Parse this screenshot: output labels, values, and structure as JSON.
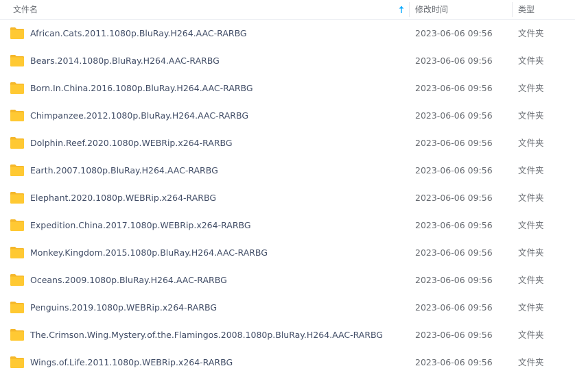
{
  "header": {
    "name_label": "文件名",
    "mtime_label": "修改时间",
    "type_label": "类型",
    "sort_icon": "arrow-up-icon",
    "sort_color": "#09aaff"
  },
  "colors": {
    "folder": "#ffc933",
    "folder_tab": "#f5b72a",
    "name_text": "#424e67",
    "meta_text": "#666a70"
  },
  "files": [
    {
      "name": "African.Cats.2011.1080p.BluRay.H264.AAC-RARBG",
      "mtime": "2023-06-06 09:56",
      "type": "文件夹",
      "icon": "folder-icon"
    },
    {
      "name": "Bears.2014.1080p.BluRay.H264.AAC-RARBG",
      "mtime": "2023-06-06 09:56",
      "type": "文件夹",
      "icon": "folder-icon"
    },
    {
      "name": "Born.In.China.2016.1080p.BluRay.H264.AAC-RARBG",
      "mtime": "2023-06-06 09:56",
      "type": "文件夹",
      "icon": "folder-icon"
    },
    {
      "name": "Chimpanzee.2012.1080p.BluRay.H264.AAC-RARBG",
      "mtime": "2023-06-06 09:56",
      "type": "文件夹",
      "icon": "folder-icon"
    },
    {
      "name": "Dolphin.Reef.2020.1080p.WEBRip.x264-RARBG",
      "mtime": "2023-06-06 09:56",
      "type": "文件夹",
      "icon": "folder-icon"
    },
    {
      "name": "Earth.2007.1080p.BluRay.H264.AAC-RARBG",
      "mtime": "2023-06-06 09:56",
      "type": "文件夹",
      "icon": "folder-icon"
    },
    {
      "name": "Elephant.2020.1080p.WEBRip.x264-RARBG",
      "mtime": "2023-06-06 09:56",
      "type": "文件夹",
      "icon": "folder-icon"
    },
    {
      "name": "Expedition.China.2017.1080p.WEBRip.x264-RARBG",
      "mtime": "2023-06-06 09:56",
      "type": "文件夹",
      "icon": "folder-icon"
    },
    {
      "name": "Monkey.Kingdom.2015.1080p.BluRay.H264.AAC-RARBG",
      "mtime": "2023-06-06 09:56",
      "type": "文件夹",
      "icon": "folder-icon"
    },
    {
      "name": "Oceans.2009.1080p.BluRay.H264.AAC-RARBG",
      "mtime": "2023-06-06 09:56",
      "type": "文件夹",
      "icon": "folder-icon"
    },
    {
      "name": "Penguins.2019.1080p.WEBRip.x264-RARBG",
      "mtime": "2023-06-06 09:56",
      "type": "文件夹",
      "icon": "folder-icon"
    },
    {
      "name": "The.Crimson.Wing.Mystery.of.the.Flamingos.2008.1080p.BluRay.H264.AAC-RARBG",
      "mtime": "2023-06-06 09:56",
      "type": "文件夹",
      "icon": "folder-icon"
    },
    {
      "name": "Wings.of.Life.2011.1080p.WEBRip.x264-RARBG",
      "mtime": "2023-06-06 09:56",
      "type": "文件夹",
      "icon": "folder-icon"
    }
  ]
}
